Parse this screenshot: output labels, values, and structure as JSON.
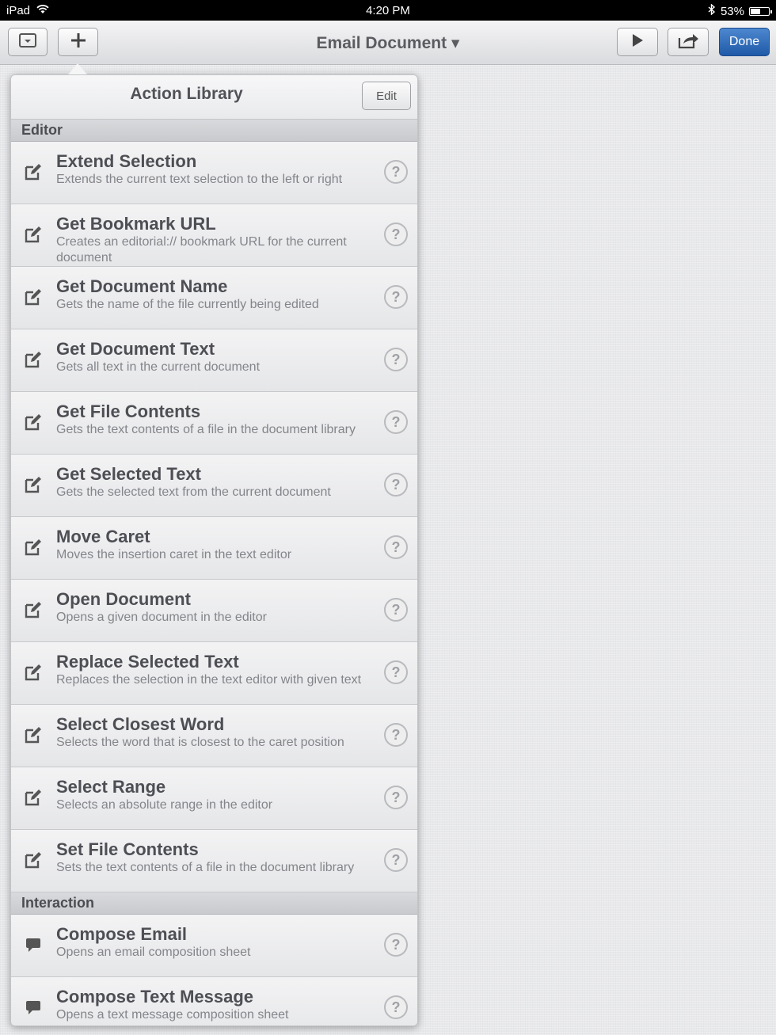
{
  "status": {
    "device": "iPad",
    "time": "4:20 PM",
    "battery": "53%",
    "battery_level": 0.53
  },
  "toolbar": {
    "title": "Email Document ▾",
    "done_label": "Done"
  },
  "popover": {
    "title": "Action Library",
    "edit_label": "Edit",
    "help_glyph": "?",
    "sections": [
      {
        "name": "Editor",
        "icon": "edit-icon",
        "items": [
          {
            "title": "Extend Selection",
            "desc": "Extends the current text selection to the left or right"
          },
          {
            "title": "Get Bookmark URL",
            "desc": "Creates an editorial:// bookmark URL for the current document"
          },
          {
            "title": "Get Document Name",
            "desc": "Gets the name of the file currently being edited"
          },
          {
            "title": "Get Document Text",
            "desc": "Gets all text in the current document"
          },
          {
            "title": "Get File Contents",
            "desc": "Gets the text contents of a file in the document library"
          },
          {
            "title": "Get Selected Text",
            "desc": "Gets the selected text from the current document"
          },
          {
            "title": "Move Caret",
            "desc": "Moves the insertion caret in the text editor"
          },
          {
            "title": "Open Document",
            "desc": "Opens a given document in the editor"
          },
          {
            "title": "Replace Selected Text",
            "desc": "Replaces the selection in the text editor with given text"
          },
          {
            "title": "Select Closest Word",
            "desc": "Selects the word that is closest to the caret position"
          },
          {
            "title": "Select Range",
            "desc": "Selects an absolute range in the editor"
          },
          {
            "title": "Set File Contents",
            "desc": "Sets the text contents of a file in the document library"
          }
        ]
      },
      {
        "name": "Interaction",
        "icon": "speech-bubble-icon",
        "items": [
          {
            "title": "Compose Email",
            "desc": "Opens an email composition sheet"
          },
          {
            "title": "Compose Text Message",
            "desc": "Opens a text message composition sheet"
          }
        ]
      }
    ]
  }
}
